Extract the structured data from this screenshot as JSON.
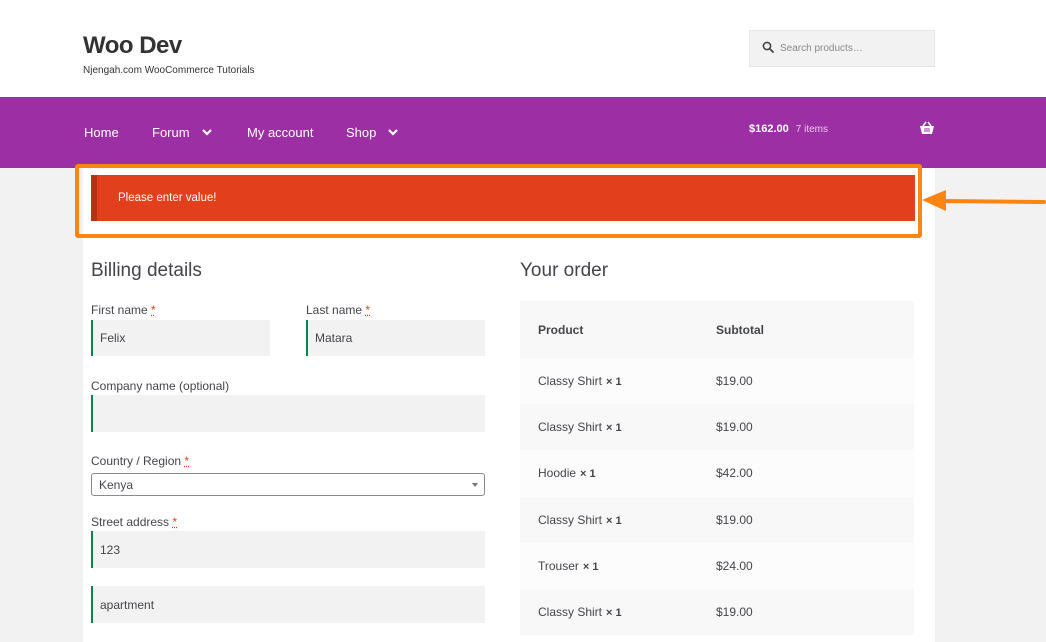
{
  "header": {
    "site_title": "Woo Dev",
    "site_tagline": "Njengah.com WooCommerce Tutorials",
    "search_placeholder": "Search products…"
  },
  "nav": {
    "items": [
      {
        "label": "Home",
        "has_dropdown": false
      },
      {
        "label": "Forum",
        "has_dropdown": true
      },
      {
        "label": "My account",
        "has_dropdown": false
      },
      {
        "label": "Shop",
        "has_dropdown": true
      }
    ],
    "cart_amount": "$162.00",
    "cart_count": "7 items",
    "bar_color": "#9d2fa4"
  },
  "notice": {
    "message": "Please enter value!",
    "color": "#e2401c",
    "highlight_color": "#fb8512"
  },
  "billing": {
    "title": "Billing details",
    "first_name_label": "First name",
    "first_name_value": "Felix",
    "last_name_label": "Last name",
    "last_name_value": "Matara",
    "company_label": "Company name (optional)",
    "company_value": "",
    "country_label": "Country / Region",
    "country_value": "Kenya",
    "street_label": "Street address",
    "street_value": "123",
    "apartment_value": "apartment",
    "required_marker": "*"
  },
  "order": {
    "title": "Your order",
    "col_product": "Product",
    "col_subtotal": "Subtotal",
    "rows": [
      {
        "product": "Classy Shirt",
        "qty": "× 1",
        "subtotal": "$19.00"
      },
      {
        "product": "Classy Shirt",
        "qty": "× 1",
        "subtotal": "$19.00"
      },
      {
        "product": "Hoodie",
        "qty": "× 1",
        "subtotal": "$42.00"
      },
      {
        "product": "Classy Shirt",
        "qty": "× 1",
        "subtotal": "$19.00"
      },
      {
        "product": "Trouser",
        "qty": "× 1",
        "subtotal": "$24.00"
      },
      {
        "product": "Classy Shirt",
        "qty": "× 1",
        "subtotal": "$19.00"
      }
    ]
  }
}
